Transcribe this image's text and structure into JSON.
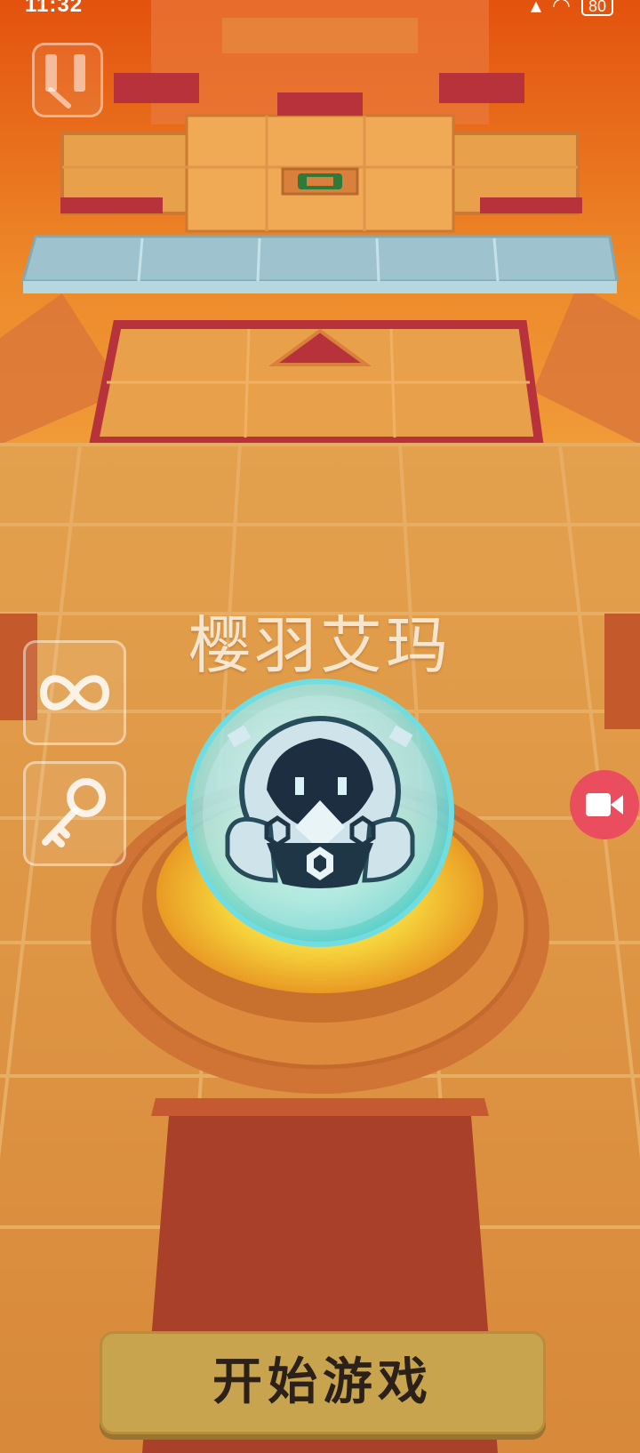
{
  "status_bar": {
    "time": "11:32",
    "battery": "80"
  },
  "game": {
    "player_name": "樱羽艾玛",
    "start_label": "开始游戏"
  },
  "colors": {
    "sky": "#e36a1a",
    "floor": "#d9913f",
    "tile_line": "#e7ad63",
    "red_block": "#b7323a",
    "glass": "#9ec3cf",
    "start_button": "#c9a44f",
    "record_button": "#ea4e5e"
  },
  "icons": {
    "pause": "pause-icon",
    "infinite": "infinity-icon",
    "key": "key-icon",
    "record": "video-camera-icon"
  }
}
